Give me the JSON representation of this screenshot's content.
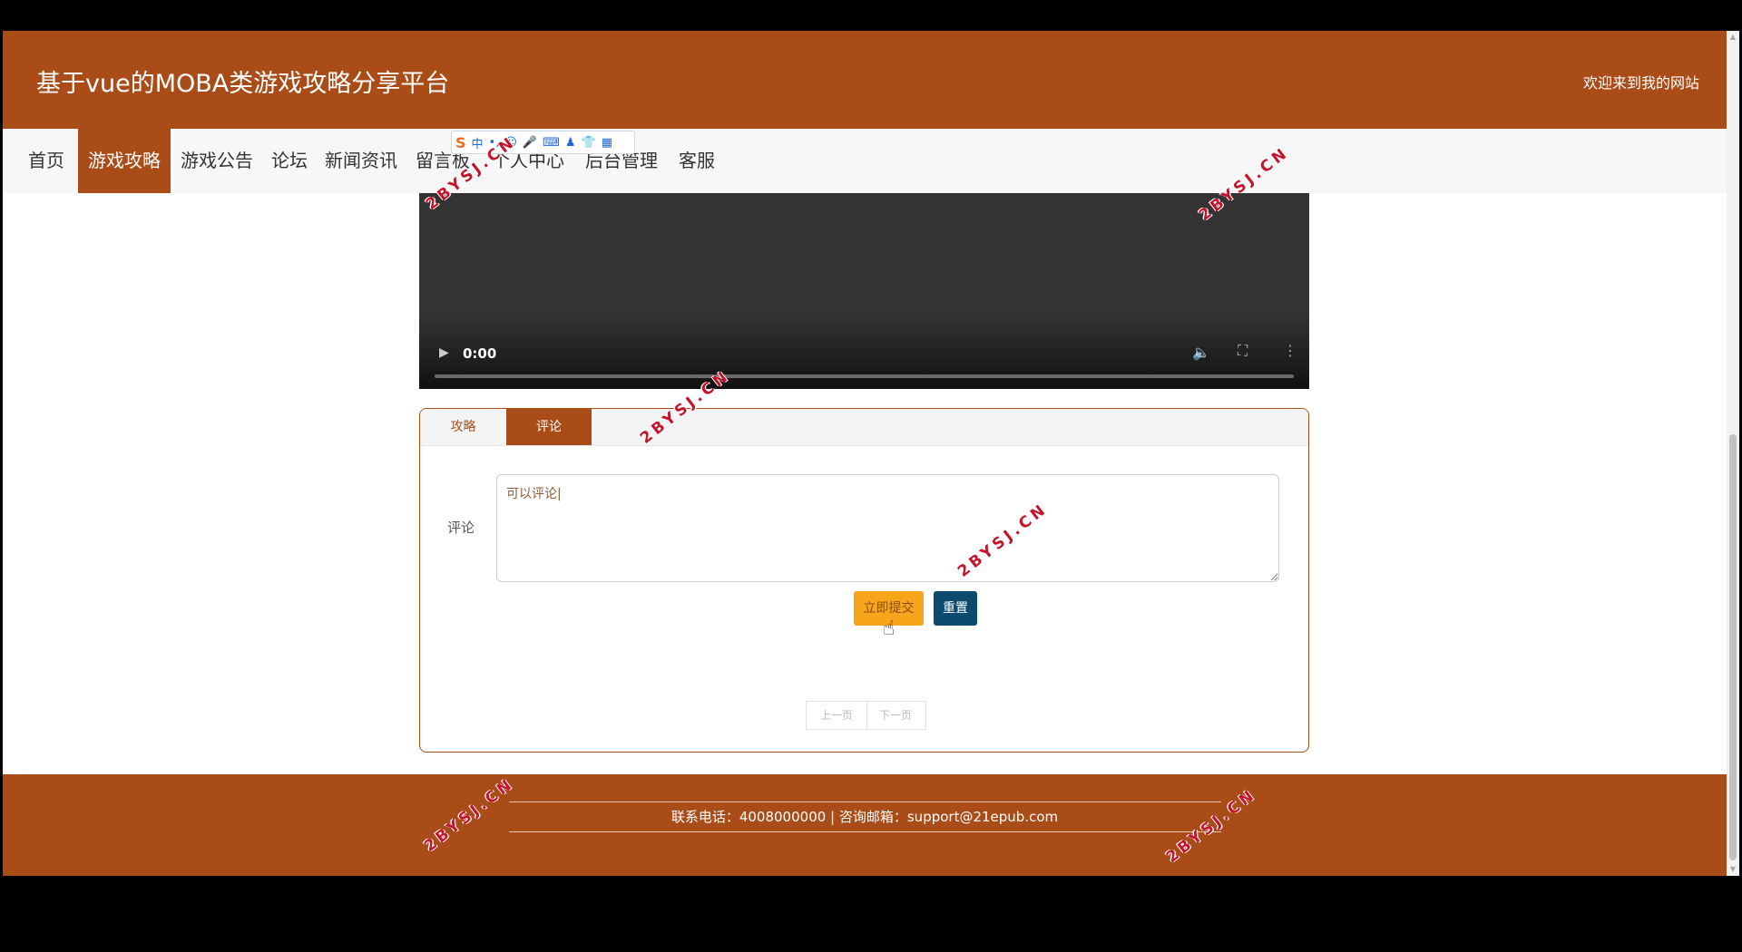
{
  "header": {
    "title": "基于vue的MOBA类游戏攻略分享平台",
    "welcome": "欢迎来到我的网站"
  },
  "nav": {
    "items": [
      {
        "label": "首页",
        "active": false
      },
      {
        "label": "游戏攻略",
        "active": true
      },
      {
        "label": "游戏公告",
        "active": false
      },
      {
        "label": "论坛",
        "active": false
      },
      {
        "label": "新闻资讯",
        "active": false
      },
      {
        "label": "留言板",
        "active": false
      },
      {
        "label": "个人中心",
        "active": false
      },
      {
        "label": "后台管理",
        "active": false
      },
      {
        "label": "客服",
        "active": false
      }
    ]
  },
  "ime": {
    "logo": "S",
    "mode": "中"
  },
  "video": {
    "time": "0:00"
  },
  "tabs": [
    {
      "label": "攻略",
      "active": false
    },
    {
      "label": "评论",
      "active": true
    }
  ],
  "comment": {
    "label": "评论",
    "value": "可以评论|"
  },
  "buttons": {
    "submit": "立即提交",
    "reset": "重置"
  },
  "pager": {
    "prev": "上一页",
    "next": "下一页"
  },
  "footer": {
    "contact": "联系电话：4008000000 | 咨询邮箱：support@21epub.com"
  },
  "watermark": "2BYSJ.CN",
  "colors": {
    "brand": "#a94c18",
    "submit": "#f7a51a",
    "reset": "#0c4a6e"
  }
}
